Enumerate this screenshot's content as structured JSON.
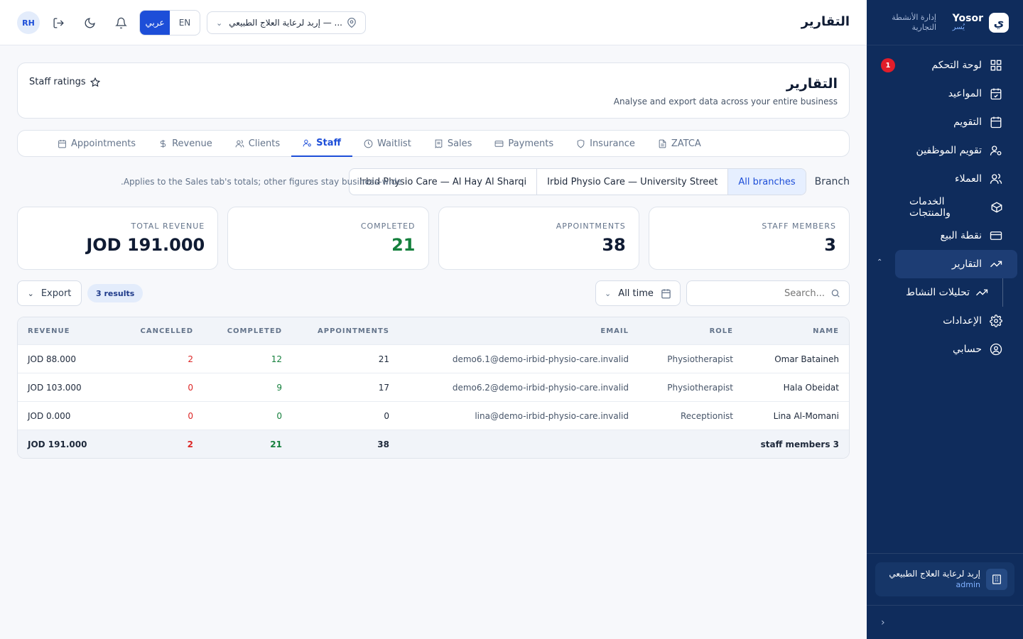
{
  "sidebar": {
    "brand_name": "Yosor",
    "brand_sub": "يُسر",
    "brand_caption": "إدارة الأنشطة التجارية",
    "items": [
      {
        "label": "لوحة التحكم",
        "icon": "dashboard-icon",
        "badge": "1"
      },
      {
        "label": "المواعيد",
        "icon": "calendar-check-icon"
      },
      {
        "label": "التقويم",
        "icon": "calendar-icon"
      },
      {
        "label": "تقويم الموظفين",
        "icon": "user-cog-icon"
      },
      {
        "label": "العملاء",
        "icon": "users-icon"
      },
      {
        "label": "الخدمات والمنتجات",
        "icon": "box-icon"
      },
      {
        "label": "نقطة البيع",
        "icon": "credit-card-icon"
      },
      {
        "label": "التقارير",
        "icon": "trending-up-icon",
        "active": true
      },
      {
        "label": "الإعدادات",
        "icon": "gear-icon"
      },
      {
        "label": "حسابي",
        "icon": "user-circle-icon"
      }
    ],
    "subitem": "تحليلات النشاط",
    "org_name": "إربد لرعاية العلاج الطبيعي",
    "org_role": "admin"
  },
  "topbar": {
    "title": "التقارير",
    "avatar": "RH",
    "lang_ar": "عربي",
    "lang_en": "EN",
    "branch_selector": "إربد لرعاية العلاج الطبيعي — ..."
  },
  "header": {
    "title": "التقارير",
    "subtitle": "Analyse and export data across your entire business",
    "staff_ratings": "Staff ratings"
  },
  "tabs": [
    {
      "label": "Appointments",
      "icon": "calendar-icon"
    },
    {
      "label": "Revenue",
      "icon": "dollar-icon"
    },
    {
      "label": "Clients",
      "icon": "users-icon"
    },
    {
      "label": "Staff",
      "icon": "user-cog-icon",
      "active": true
    },
    {
      "label": "Waitlist",
      "icon": "clock-icon"
    },
    {
      "label": "Sales",
      "icon": "receipt-icon"
    },
    {
      "label": "Payments",
      "icon": "credit-card-icon"
    },
    {
      "label": "Insurance",
      "icon": "shield-icon"
    },
    {
      "label": "ZATCA",
      "icon": "document-icon"
    }
  ],
  "branch": {
    "label": "Branch",
    "note": ".Applies to the Sales tab's totals; other figures stay business-wide",
    "options": [
      "Irbid Physio Care — Al Hay Al Sharqi",
      "Irbid Physio Care — University Street",
      "All branches"
    ],
    "selected": "All branches"
  },
  "stats": [
    {
      "label": "STAFF MEMBERS",
      "value": "3"
    },
    {
      "label": "APPOINTMENTS",
      "value": "38"
    },
    {
      "label": "COMPLETED",
      "value": "21"
    },
    {
      "label": "TOTAL REVENUE",
      "value": "JOD 191.000"
    }
  ],
  "toolbar": {
    "export": "Export",
    "results": "3 results",
    "period": "All time",
    "search_placeholder": "Search..."
  },
  "table": {
    "headers": {
      "revenue": "REVENUE",
      "cancelled": "CANCELLED",
      "completed": "COMPLETED",
      "appointments": "APPOINTMENTS",
      "email": "EMAIL",
      "role": "ROLE",
      "name": "NAME"
    },
    "rows": [
      {
        "revenue": "JOD 88.000",
        "cancelled": "2",
        "completed": "12",
        "appointments": "21",
        "email": "demo6.1@demo-irbid-physio-care.invalid",
        "role": "Physiotherapist",
        "name": "Omar Bataineh"
      },
      {
        "revenue": "JOD 103.000",
        "cancelled": "0",
        "completed": "9",
        "appointments": "17",
        "email": "demo6.2@demo-irbid-physio-care.invalid",
        "role": "Physiotherapist",
        "name": "Hala Obeidat"
      },
      {
        "revenue": "JOD 0.000",
        "cancelled": "0",
        "completed": "0",
        "appointments": "0",
        "email": "lina@demo-irbid-physio-care.invalid",
        "role": "Receptionist",
        "name": "Lina Al-Momani"
      }
    ],
    "total": {
      "revenue": "JOD 191.000",
      "cancelled": "2",
      "completed": "21",
      "appointments": "38",
      "name": "staff members 3"
    }
  },
  "colors": {
    "sidebar": "#0f2c5c",
    "accent": "#1d4ed8",
    "green": "#15803d",
    "red": "#dc2626"
  }
}
